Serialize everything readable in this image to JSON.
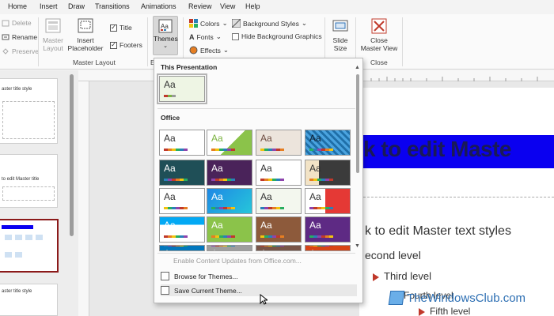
{
  "tabs": [
    "Home",
    "Insert",
    "Draw",
    "Transitions",
    "Animations",
    "Review",
    "View",
    "Help"
  ],
  "ribbon": {
    "edit_master": {
      "delete": "Delete",
      "rename": "Rename",
      "preserve": "Preserve"
    },
    "master_layout": {
      "master_layout_btn": "Master Layout",
      "insert_placeholder": "Insert Placeholder",
      "title_label": "Title",
      "footers_label": "Footers",
      "group_label": "Master Layout"
    },
    "edit_theme": {
      "themes": "Themes",
      "group_label_partial": "E"
    },
    "background": {
      "colors": "Colors",
      "fonts": "Fonts",
      "effects": "Effects",
      "background_styles": "Background Styles",
      "hide_background_graphics": "Hide Background Graphics"
    },
    "size": {
      "slide_size": "Slide Size"
    },
    "close": {
      "close_master_view": "Close Master View",
      "group_label": "Close"
    }
  },
  "thumbnails": {
    "thumb1_text": "aster title style",
    "thumb2_text": "to edit Master title",
    "thumb3_text": "aster title style"
  },
  "slide": {
    "title": "k to edit Maste",
    "body_first": "k to edit Master text styles",
    "level2": "econd level",
    "level3": "Third level",
    "level4": "Fourth level",
    "level5": "Fifth level"
  },
  "dropdown": {
    "this_presentation": "This Presentation",
    "office": "Office",
    "theme_sample": "Aa",
    "enable_updates": "Enable Content Updates from Office.com...",
    "browse": "Browse for Themes...",
    "save": "Save Current Theme..."
  },
  "watermark": "TheWindowsClub.com",
  "colors": {
    "title_strip": "#0a00f0",
    "accent_red": "#c0392b",
    "selected_thumb_border": "#8b1a1a"
  }
}
